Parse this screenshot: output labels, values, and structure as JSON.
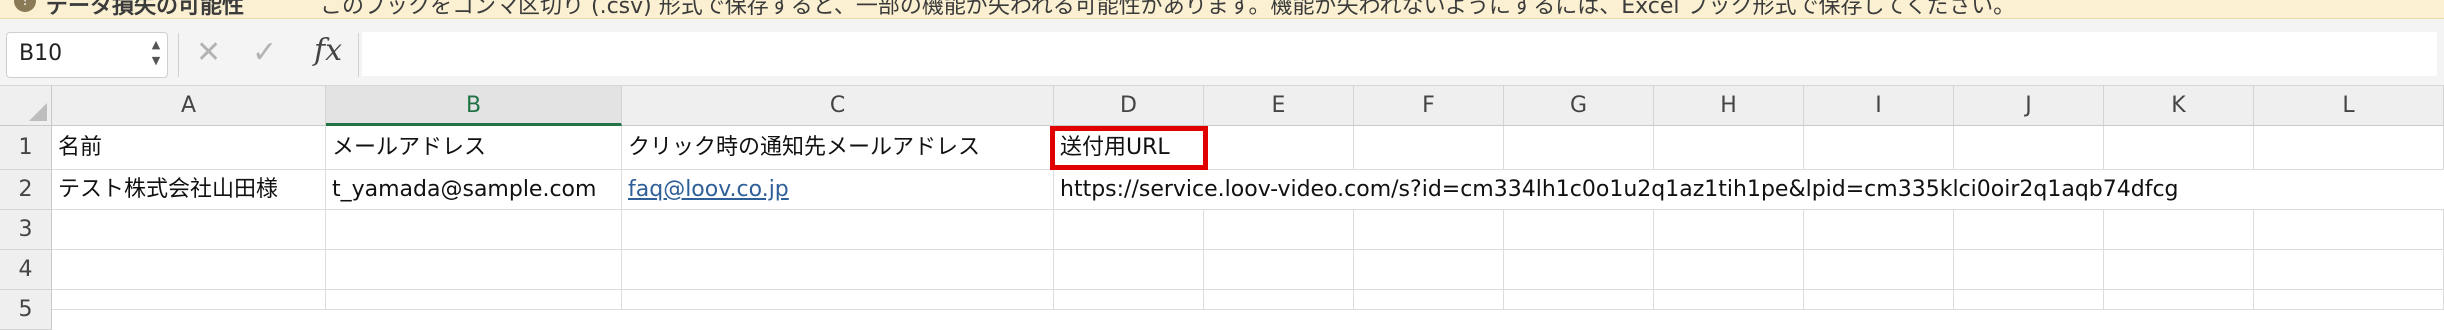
{
  "warning_bar": {
    "title": "データ損失の可能性",
    "message": "このブックをコンマ区切り (.csv) 形式で保存すると、一部の機能が失われる可能性があります。機能が失われないようにするには、Excel ブック形式で保存してください。"
  },
  "formula_bar": {
    "name_box": "B10",
    "fx_label": "fx",
    "formula": ""
  },
  "grid": {
    "columns": [
      "A",
      "B",
      "C",
      "D",
      "E",
      "F",
      "G",
      "H",
      "I",
      "J",
      "K",
      "L"
    ],
    "selected_column": "B",
    "rows": [
      {
        "num": "1",
        "A": "名前",
        "B": "メールアドレス",
        "C": "クリック時の通知先メールアドレス",
        "D": "送付用URL"
      },
      {
        "num": "2",
        "A": "テスト株式会社山田様",
        "B": "t_yamada@sample.com",
        "C": "faq@loov.co.jp",
        "D": "https://service.loov-video.com/s?id=cm334lh1c0o1u2q1az1tih1pe&lpid=cm335klci0oir2q1aqb74dfcg"
      },
      {
        "num": "3"
      },
      {
        "num": "4"
      },
      {
        "num": "5"
      }
    ],
    "highlight": {
      "cell": "D1",
      "color": "#e00000"
    }
  },
  "colors": {
    "accent_green": "#217346",
    "link": "#2e5f98",
    "highlight_red": "#e00000"
  }
}
